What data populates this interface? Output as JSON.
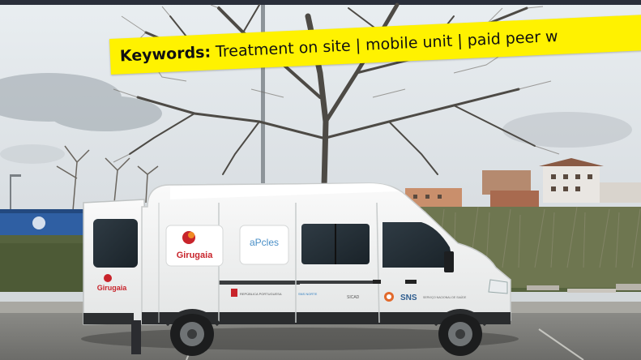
{
  "banner": {
    "label": "Keywords:",
    "text": " Treatment on site | mobile unit | paid peer w"
  },
  "van": {
    "logo_primary": "Girugaia",
    "logo_secondary": "aPcles",
    "rear_logo": "Girugaia",
    "sns_label": "SNS",
    "sponsor_1": "REPÚBLICA PORTUGUESA",
    "sponsor_2": "SNS NORTE",
    "sponsor_3": "SICAD",
    "sponsor_4": "SERVIÇO NACIONAL DE SAÚDE"
  },
  "colors": {
    "banner_yellow": "#fff200",
    "van_white": "#f4f5f4",
    "logo_red": "#c8242b",
    "logo_orange": "#f08a24"
  }
}
